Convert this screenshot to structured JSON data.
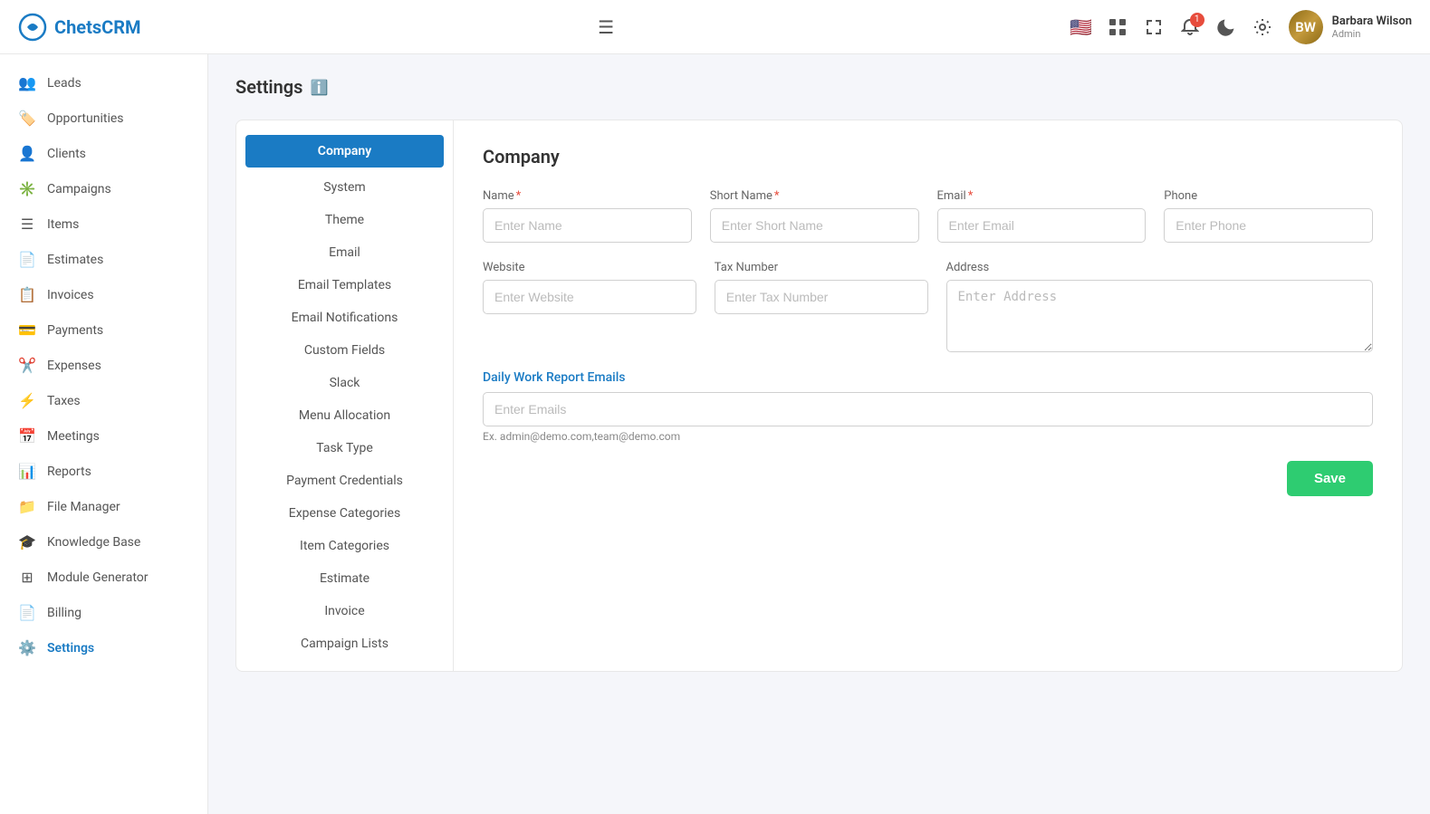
{
  "app": {
    "name": "ChetsCRM",
    "logo_symbol": "⬡"
  },
  "topnav": {
    "notification_count": "1",
    "user": {
      "name": "Barbara Wilson",
      "role": "Admin"
    }
  },
  "sidebar": {
    "items": [
      {
        "id": "leads",
        "label": "Leads",
        "icon": "👥"
      },
      {
        "id": "opportunities",
        "label": "Opportunities",
        "icon": "🏷️"
      },
      {
        "id": "clients",
        "label": "Clients",
        "icon": "👤"
      },
      {
        "id": "campaigns",
        "label": "Campaigns",
        "icon": "✳️"
      },
      {
        "id": "items",
        "label": "Items",
        "icon": "☰"
      },
      {
        "id": "estimates",
        "label": "Estimates",
        "icon": "📄"
      },
      {
        "id": "invoices",
        "label": "Invoices",
        "icon": "📋"
      },
      {
        "id": "payments",
        "label": "Payments",
        "icon": "💳"
      },
      {
        "id": "expenses",
        "label": "Expenses",
        "icon": "✂️"
      },
      {
        "id": "taxes",
        "label": "Taxes",
        "icon": "⚡"
      },
      {
        "id": "meetings",
        "label": "Meetings",
        "icon": "📅"
      },
      {
        "id": "reports",
        "label": "Reports",
        "icon": "📊"
      },
      {
        "id": "file-manager",
        "label": "File Manager",
        "icon": "📁"
      },
      {
        "id": "knowledge-base",
        "label": "Knowledge Base",
        "icon": "🎓"
      },
      {
        "id": "module-generator",
        "label": "Module Generator",
        "icon": "⊞"
      },
      {
        "id": "billing",
        "label": "Billing",
        "icon": "📄"
      },
      {
        "id": "settings",
        "label": "Settings",
        "icon": "⚙️",
        "active": true
      }
    ]
  },
  "page": {
    "title": "Settings",
    "info_icon": "ℹ"
  },
  "settings_sidebar": {
    "items": [
      {
        "id": "company",
        "label": "Company",
        "active": true
      },
      {
        "id": "system",
        "label": "System"
      },
      {
        "id": "theme",
        "label": "Theme"
      },
      {
        "id": "email",
        "label": "Email"
      },
      {
        "id": "email-templates",
        "label": "Email Templates"
      },
      {
        "id": "email-notifications",
        "label": "Email Notifications"
      },
      {
        "id": "custom-fields",
        "label": "Custom Fields"
      },
      {
        "id": "slack",
        "label": "Slack"
      },
      {
        "id": "menu-allocation",
        "label": "Menu Allocation"
      },
      {
        "id": "task-type",
        "label": "Task Type"
      },
      {
        "id": "payment-credentials",
        "label": "Payment Credentials"
      },
      {
        "id": "expense-categories",
        "label": "Expense Categories"
      },
      {
        "id": "item-categories",
        "label": "Item Categories"
      },
      {
        "id": "estimate",
        "label": "Estimate"
      },
      {
        "id": "invoice",
        "label": "Invoice"
      },
      {
        "id": "campaign-lists",
        "label": "Campaign Lists"
      }
    ]
  },
  "company_form": {
    "section_title": "Company",
    "fields": {
      "name": {
        "label": "Name",
        "required": true,
        "placeholder": "Enter Name"
      },
      "short_name": {
        "label": "Short Name",
        "required": true,
        "placeholder": "Enter Short Name"
      },
      "email": {
        "label": "Email",
        "required": true,
        "placeholder": "Enter Email"
      },
      "phone": {
        "label": "Phone",
        "required": false,
        "placeholder": "Enter Phone"
      },
      "website": {
        "label": "Website",
        "required": false,
        "placeholder": "Enter Website"
      },
      "tax_number": {
        "label": "Tax Number",
        "required": false,
        "placeholder": "Enter Tax Number"
      },
      "address": {
        "label": "Address",
        "required": false,
        "placeholder": "Enter Address"
      }
    },
    "daily_work_report": {
      "label": "Daily Work Report Emails",
      "placeholder": "Enter Emails",
      "hint": "Ex. admin@demo.com,team@demo.com"
    },
    "save_button": "Save"
  }
}
